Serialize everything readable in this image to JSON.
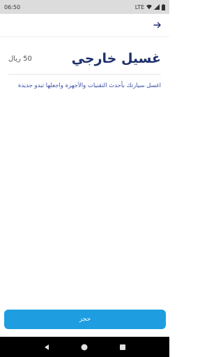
{
  "status_bar": {
    "time": "06:50",
    "network": "LTE",
    "icons": [
      "wifi-icon",
      "signal-icon",
      "battery-icon"
    ]
  },
  "app_bar": {
    "back_icon": "arrow-right-icon"
  },
  "service": {
    "title": "غسيل خارجي",
    "price": "50 ريال",
    "description": "اغسل سيارتك بأحدث التقنيات والأجهزة واجعلها تبدو جديدة"
  },
  "actions": {
    "book_label": "حجز"
  },
  "nav_bar": {
    "icons": [
      "back-triangle-icon",
      "home-circle-icon",
      "recents-square-icon"
    ]
  },
  "colors": {
    "title": "#1d2f6b",
    "description": "#3b4ea8",
    "button": "#1e9ee0",
    "status_bar": "#dcdcdc"
  }
}
